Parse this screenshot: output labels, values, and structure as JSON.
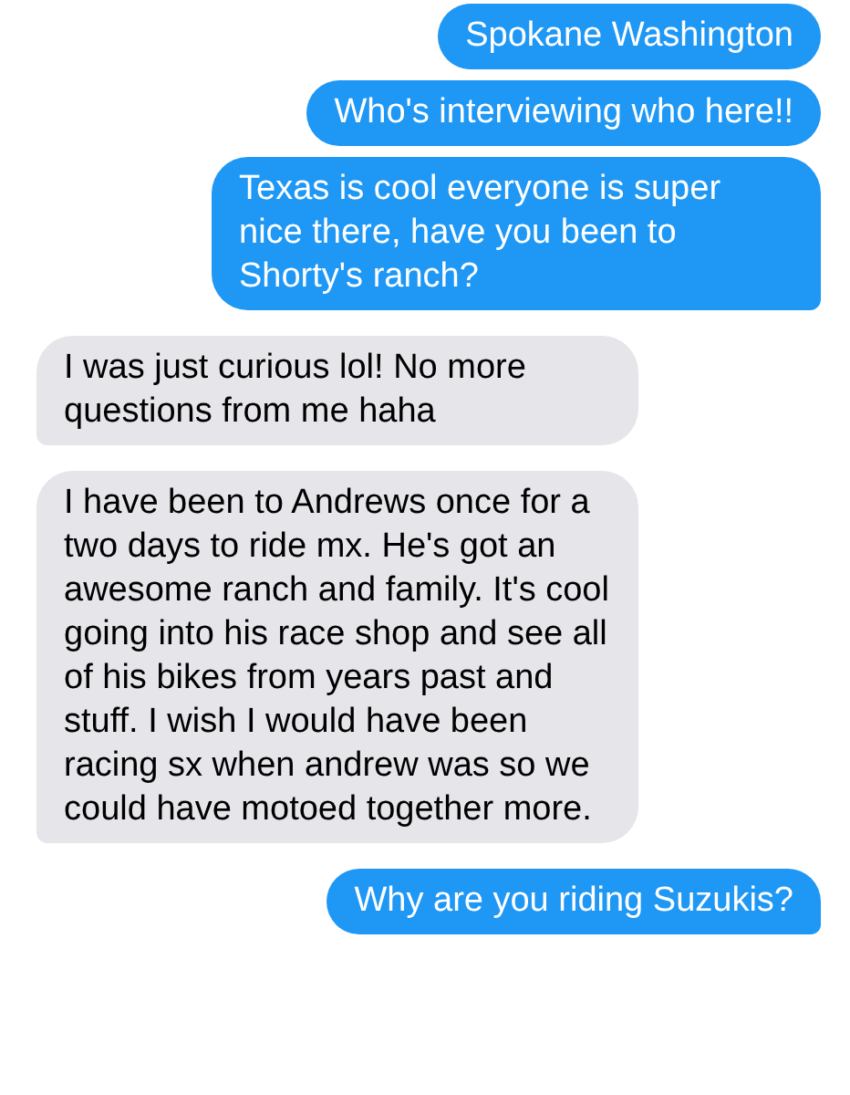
{
  "messages": [
    {
      "kind": "sent",
      "text": "Spokane Washington",
      "tail": false
    },
    {
      "kind": "sent",
      "text": "Who's interviewing who here!!",
      "tail": false
    },
    {
      "kind": "sent",
      "text": "Texas is cool everyone is super nice there, have you been to Shorty's ranch?",
      "tail": true
    },
    {
      "kind": "received",
      "text": "I was just curious lol! No more questions from me haha",
      "tail": true
    },
    {
      "kind": "received",
      "text": "I have been to Andrews once for a two days to ride mx. He's got an awesome ranch and family. It's cool going into his race shop and see all of his bikes from years past and stuff. I wish I would have been racing sx when andrew was so we could have motoed together more.",
      "tail": true
    },
    {
      "kind": "sent",
      "text": "Why are you riding Suzukis?",
      "tail": true
    }
  ]
}
